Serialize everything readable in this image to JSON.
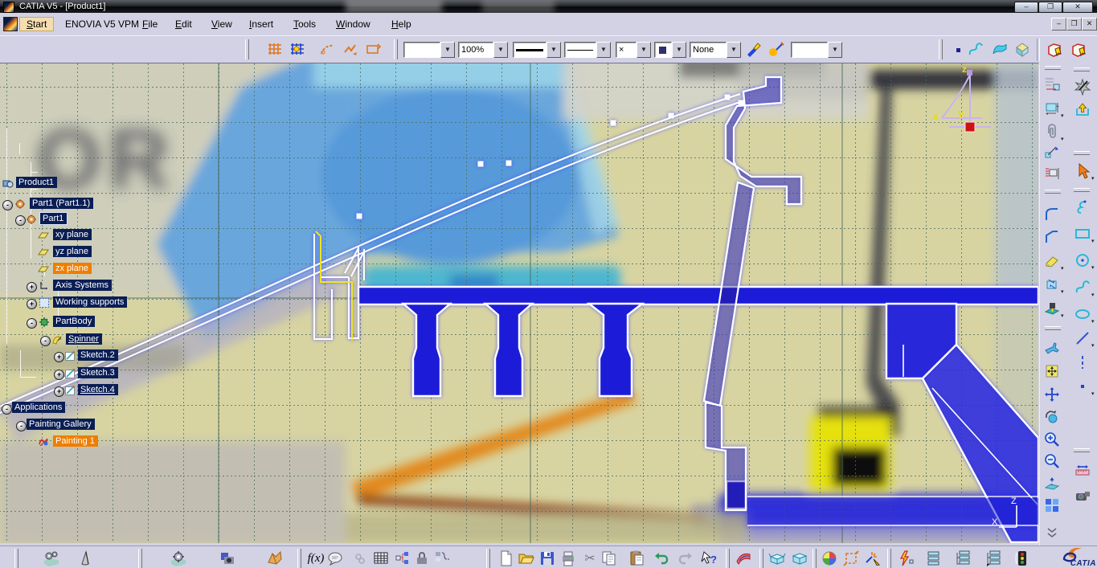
{
  "window": {
    "title": "CATIA V5 - [Product1]",
    "controls": {
      "minimize": "–",
      "restore": "❐",
      "close": "✕"
    }
  },
  "menu": {
    "items": [
      {
        "label": "Start"
      },
      {
        "label": "ENOVIA V5 VPM"
      },
      {
        "label": "File"
      },
      {
        "label": "Edit"
      },
      {
        "label": "View"
      },
      {
        "label": "Insert"
      },
      {
        "label": "Tools"
      },
      {
        "label": "Window"
      },
      {
        "label": "Help"
      }
    ],
    "mdi_controls": {
      "minimize": "–",
      "restore": "❐",
      "close": "✕"
    }
  },
  "top_toolbar": {
    "dropdowns": {
      "color_value": "",
      "zoom_value": "100%",
      "line_weight_value": "",
      "line_type_value": "",
      "point_symbol_value": "×",
      "pattern_value": "",
      "render_style_value": "None",
      "layer_value": ""
    },
    "icons": [
      "grid-icon",
      "snap-to-point-icon",
      "construction-element-icon",
      "geometrical-constraints-icon",
      "dimensional-constraints-icon",
      "paint-brush-icon",
      "wizard-icon",
      "point-icon",
      "spline-icon",
      "surface-icon",
      "volume-icon",
      "catalog-browser-icon",
      "catalog-browser-2-icon"
    ]
  },
  "right_toolbar": {
    "column_a_icons": [
      "constraints-dialog-icon",
      "constraint-icon",
      "auto-constraint-icon",
      "diagonal-dimension-icon",
      "animate-constraint-icon",
      "corner-icon",
      "chamfer-icon",
      "quick-trim-icon",
      "trim-icon",
      "project-3d-elements-icon",
      "fly-mode-icon",
      "fit-all-in-icon",
      "pan-icon",
      "rotate-icon",
      "zoom-in-icon",
      "zoom-out-icon",
      "normal-view-icon",
      "create-multi-view-icon",
      "more-chevron-icon"
    ],
    "column_b_icons": [
      "exit-workbench-star-icon",
      "exit-workbench-icon",
      "select-arrow-icon",
      "profile-icon",
      "rectangle-icon",
      "circle-icon",
      "spline-icon",
      "ellipse-icon",
      "line-icon",
      "axis-icon",
      "point-icon",
      "measure-between-icon",
      "render-camera-icon"
    ]
  },
  "bottom_toolbar": {
    "icons": [
      "gears-icon",
      "cone-icon",
      "gear-icon",
      "capture-camera-icon",
      "fold-surface-icon",
      "formula-icon",
      "comment-icon",
      "link-icon",
      "design-table-icon",
      "diagram-icon",
      "lock-icon",
      "group-icon",
      "new-file-icon",
      "open-folder-icon",
      "save-icon",
      "print-icon",
      "cut-icon",
      "copy-icon",
      "paste-icon",
      "undo-icon",
      "redo-icon",
      "context-help-icon",
      "surface-red-icon",
      "open-box-icon",
      "closed-box-icon",
      "color-wheel-icon",
      "transform-icon",
      "spray-icon",
      "bolt-icon",
      "list-icon",
      "tree-list-icon",
      "tree-list-2-icon",
      "traffic-light-icon"
    ]
  },
  "tree": {
    "items": [
      {
        "label": "Product1",
        "knob": "",
        "icon": "product"
      },
      {
        "label": "Part1 (Part1.1)",
        "knob": "-",
        "icon": "part"
      },
      {
        "label": "Part1",
        "knob": "-",
        "icon": "part",
        "selected": "outline"
      },
      {
        "label": "xy plane",
        "knob": "",
        "icon": "plane"
      },
      {
        "label": "yz plane",
        "knob": "",
        "icon": "plane"
      },
      {
        "label": "zx plane",
        "knob": "",
        "icon": "plane",
        "selected": "orange"
      },
      {
        "label": "Axis Systems",
        "knob": "+",
        "icon": "axis"
      },
      {
        "label": "Working supports",
        "knob": "+",
        "icon": "ws"
      },
      {
        "label": "PartBody",
        "knob": "-",
        "icon": "body"
      },
      {
        "label": "Spinner",
        "knob": "-",
        "icon": "spin",
        "underline": true
      },
      {
        "label": "Sketch.2",
        "knob": "+",
        "icon": "sketch"
      },
      {
        "label": "Sketch.3",
        "knob": "+",
        "icon": "sketch"
      },
      {
        "label": "Sketch.4",
        "knob": "+",
        "icon": "sketch",
        "underline": true
      },
      {
        "label": "Applications",
        "knob": "-",
        "icon": ""
      },
      {
        "label": "Painting Gallery",
        "knob": "-",
        "icon": ""
      },
      {
        "label": "Painting 1",
        "knob": "",
        "icon": "paint",
        "selected": "orange"
      }
    ]
  },
  "canvas": {
    "background_text": "OR",
    "compass": {
      "x": "x",
      "y": "y",
      "z": "z"
    },
    "axis_indicator": {
      "horizontal": "X",
      "vertical": "Z"
    }
  },
  "logo": {
    "brand": "CATIA"
  }
}
